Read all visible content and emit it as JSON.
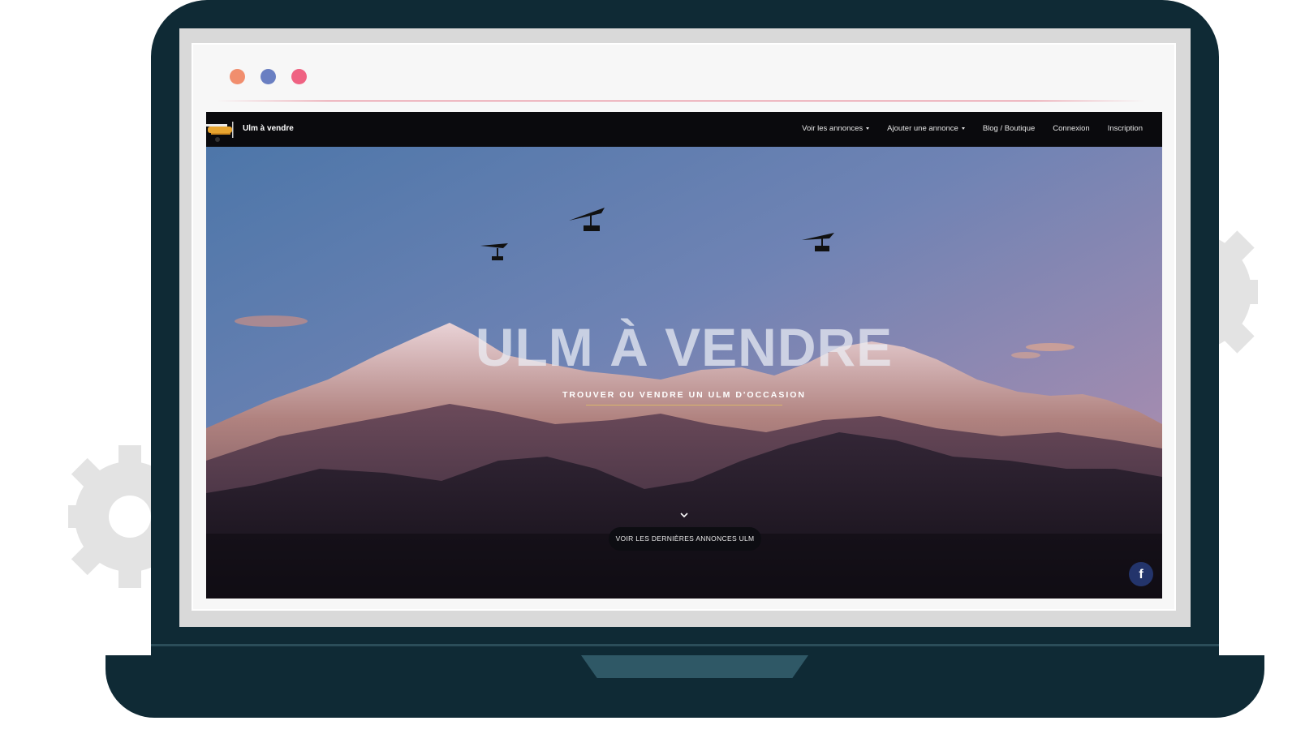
{
  "browser": {
    "dot_colors": [
      "#f18e6e",
      "#6a7fc2",
      "#ef6282"
    ]
  },
  "site": {
    "brand": "Ulm à vendre",
    "nav": [
      {
        "label": "Voir les annonces",
        "dropdown": true
      },
      {
        "label": "Ajouter une annonce",
        "dropdown": true
      },
      {
        "label": "Blog / Boutique",
        "dropdown": false
      },
      {
        "label": "Connexion",
        "dropdown": false
      },
      {
        "label": "Inscription",
        "dropdown": false
      }
    ],
    "hero": {
      "title": "ULM À VENDRE",
      "subtitle": "TROUVER OU VENDRE UN ULM D'OCCASION",
      "cta": "VOIR LES DERNIÈRES ANNONCES ULM"
    },
    "social": {
      "facebook_glyph": "f"
    }
  },
  "icons": [
    "gear-icon",
    "plane-logo-icon",
    "caret-down-icon",
    "chevron-down-icon",
    "facebook-icon",
    "microlight-icon"
  ],
  "colors": {
    "laptop": "#0f2a35",
    "nav_bg": "#0a0a0d",
    "accent_line": "#d8b56a",
    "facebook": "#23346b"
  }
}
